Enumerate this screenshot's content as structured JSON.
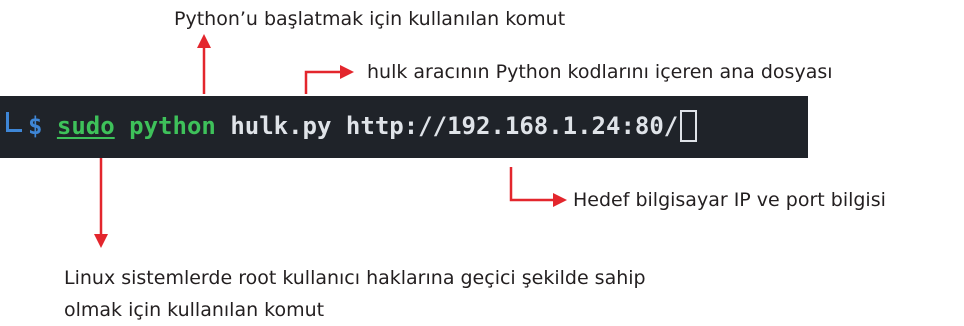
{
  "annotations": {
    "python_start": "Python’u başlatmak için kullanılan komut",
    "hulk_main_file": "hulk aracının Python kodlarını içeren ana dosyası",
    "target_ip_port": "Hedef bilgisayar IP ve port bilgisi",
    "sudo_line1": "Linux sistemlerde root kullanıcı haklarına geçici şekilde sahip",
    "sudo_line2": "olmak için kullanılan komut"
  },
  "terminal": {
    "prompt": "$ ",
    "sudo": "sudo",
    "python": "python",
    "script": "hulk.py",
    "url": "http://192.168.1.24:80/"
  },
  "colors": {
    "arrow": "#e3262d",
    "terminal_bg": "#1f2329",
    "prompt": "#3e86d6",
    "command_green": "#3ec15a",
    "argument_text": "#dfe3e8"
  }
}
